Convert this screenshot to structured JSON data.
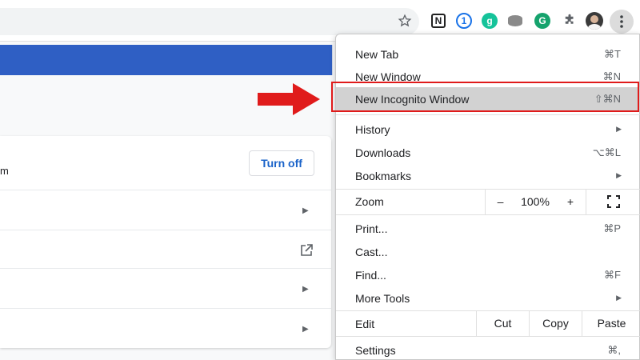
{
  "settings_card": {
    "row1_text_fragment": "m",
    "turn_off_label": "Turn off"
  },
  "menu": {
    "new_tab": {
      "label": "New Tab",
      "shortcut": "⌘T"
    },
    "new_window": {
      "label": "New Window",
      "shortcut": "⌘N"
    },
    "new_incognito": {
      "label": "New Incognito Window",
      "shortcut": "⇧⌘N"
    },
    "history": {
      "label": "History"
    },
    "downloads": {
      "label": "Downloads",
      "shortcut": "⌥⌘L"
    },
    "bookmarks": {
      "label": "Bookmarks"
    },
    "zoom": {
      "label": "Zoom",
      "minus": "–",
      "level": "100%",
      "plus": "+"
    },
    "print": {
      "label": "Print...",
      "shortcut": "⌘P"
    },
    "cast": {
      "label": "Cast..."
    },
    "find": {
      "label": "Find...",
      "shortcut": "⌘F"
    },
    "more_tools": {
      "label": "More Tools"
    },
    "edit": {
      "label": "Edit",
      "cut": "Cut",
      "copy": "Copy",
      "paste": "Paste"
    },
    "settings": {
      "label": "Settings",
      "shortcut": "⌘,"
    }
  },
  "toolbar_icons": [
    "star-icon",
    "notion-icon",
    "onepassword-icon",
    "grammarly-icon",
    "storage-icon",
    "grammarly-go-icon",
    "puzzle-icon",
    "avatar",
    "kebab-menu-icon"
  ],
  "colors": {
    "highlight_red": "#e01b1b",
    "header_blue": "#2f5fc4",
    "link_blue": "#1a63c9",
    "menu_hover": "#d2d2d2"
  }
}
